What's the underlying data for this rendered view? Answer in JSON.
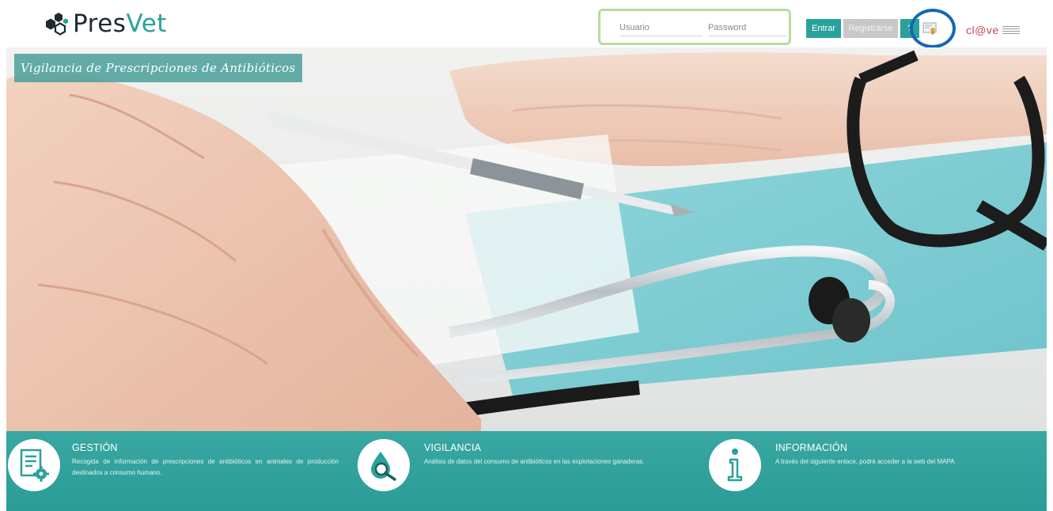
{
  "header": {
    "logo": {
      "text_main": "Pres",
      "text_accent": "Vet"
    },
    "login": {
      "user_placeholder": "Usuario",
      "password_placeholder": "Password"
    },
    "buttons": {
      "entrar": "Entrar",
      "registrarse": "Registrarse",
      "help": "?"
    },
    "clave_logo": "cl@ve"
  },
  "hero": {
    "subtitle": "Vigilancia de Prescripciones de Antibióticos"
  },
  "features": [
    {
      "icon": "document-gear-icon",
      "title": "GESTIÓN",
      "description": "Recogida de información de prescripciones de antibióticos en animales de producción destinados a consumo humano."
    },
    {
      "icon": "drop-magnifier-icon",
      "title": "VIGILANCIA",
      "description": "Análisis de datos del consumo de antibióticos en las explotaciones ganaderas."
    },
    {
      "icon": "info-icon",
      "title": "INFORMACIÓN",
      "description": "A través del siguiente enlace, podrá acceder a la web del MAPA"
    }
  ],
  "colors": {
    "teal": "#2aa19b",
    "login_border": "#b9dc9c",
    "highlight_ring": "#1566b7",
    "clave_red": "#c44a59"
  }
}
